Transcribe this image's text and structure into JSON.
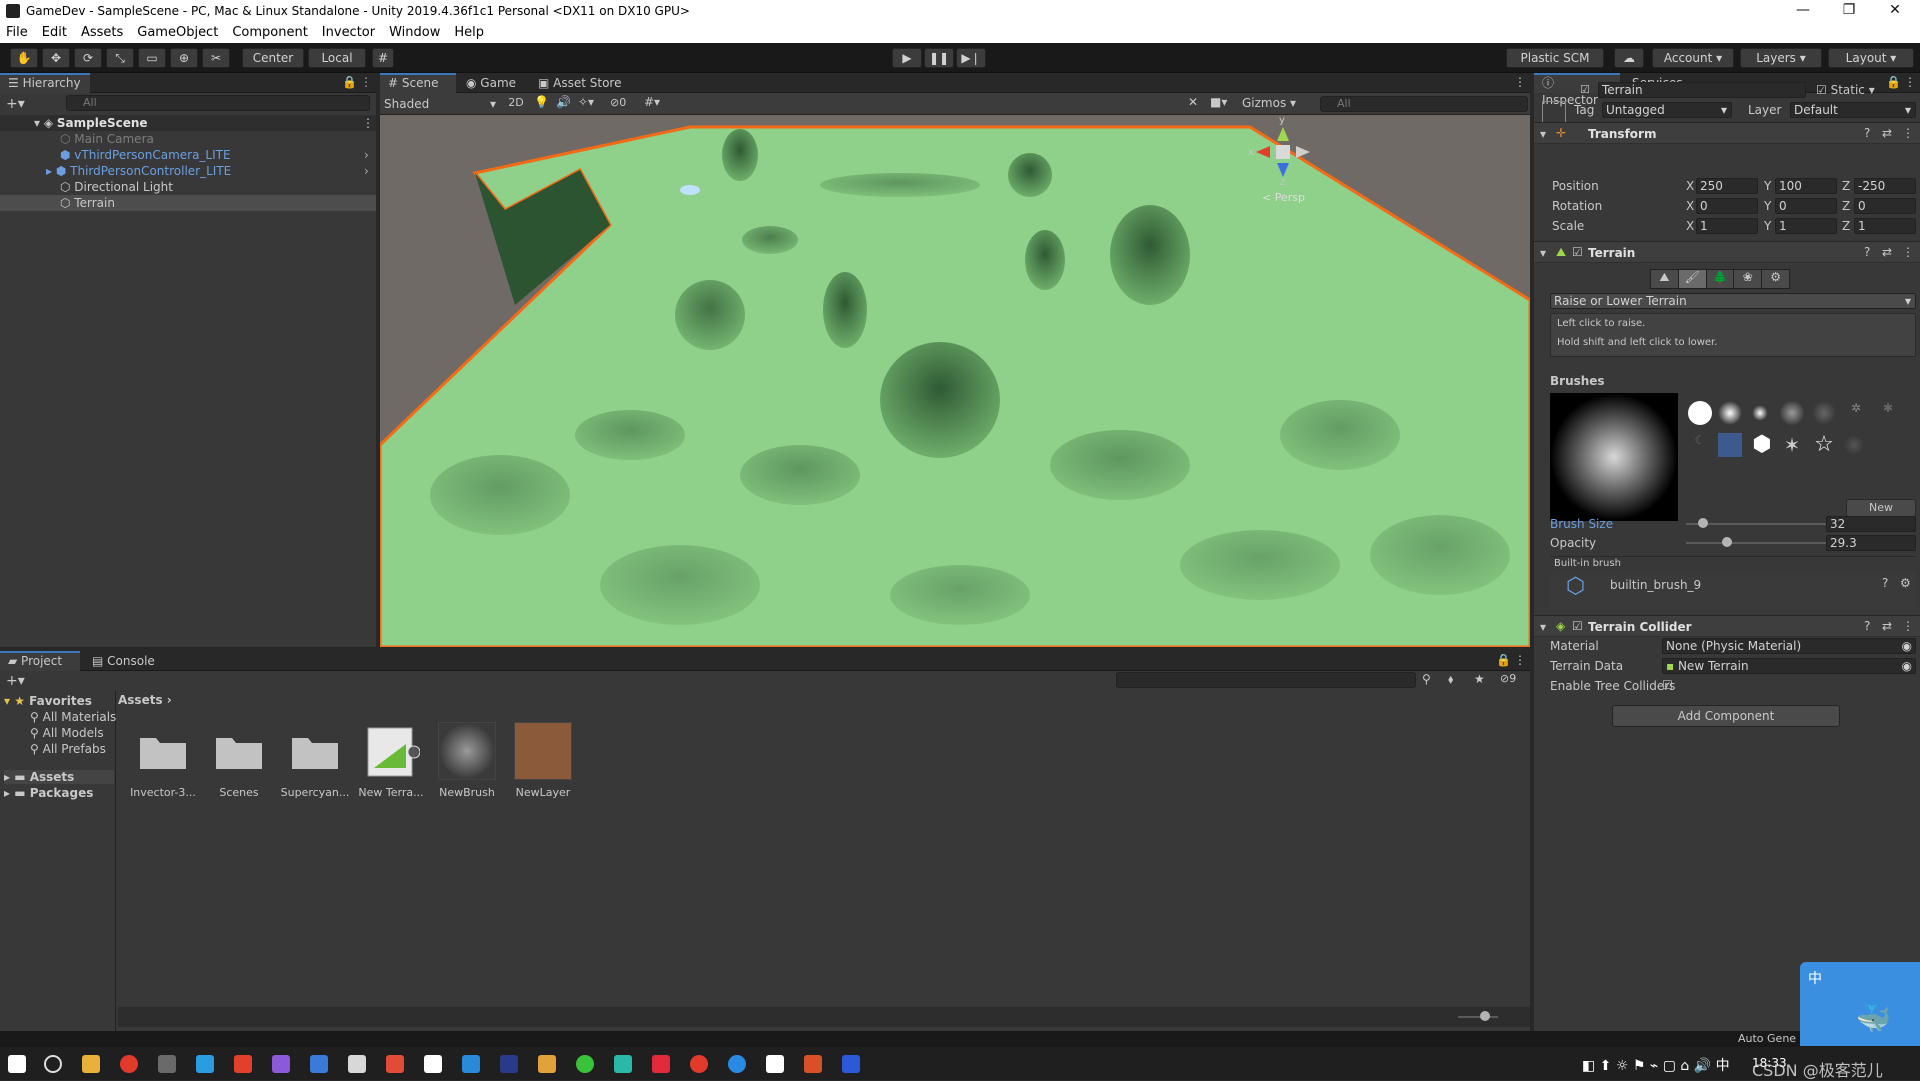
{
  "window": {
    "title": "GameDev - SampleScene - PC, Mac & Linux Standalone - Unity 2019.4.36f1c1 Personal <DX11 on DX10 GPU>",
    "controls": [
      "—",
      "❐",
      "✕"
    ]
  },
  "menu": [
    "File",
    "Edit",
    "Assets",
    "GameObject",
    "Component",
    "Invector",
    "Window",
    "Help"
  ],
  "toolbar": {
    "pivot_label": "Center",
    "space_label": "Local",
    "plastic_label": "Plastic SCM",
    "account_label": "Account",
    "layers_label": "Layers",
    "layout_label": "Layout"
  },
  "hierarchy": {
    "tab": "Hierarchy",
    "search_placeholder": "All",
    "scene_name": "SampleScene",
    "items": [
      {
        "label": "Main Camera",
        "color": "#7d7d7d"
      },
      {
        "label": "vThirdPersonCamera_LITE",
        "color": "#6a9fe0"
      },
      {
        "label": "ThirdPersonController_LITE",
        "color": "#6a9fe0"
      },
      {
        "label": "Directional Light",
        "color": "#c8c8c8"
      },
      {
        "label": "Terrain",
        "color": "#c8c8c8"
      }
    ]
  },
  "scene": {
    "tabs": [
      "Scene",
      "Game",
      "Asset Store"
    ],
    "shading": "Shaded",
    "mode_2d": "2D",
    "hidden_count": "0",
    "gizmos": "Gizmos",
    "search_placeholder": "All",
    "axis_y": "y",
    "axis_x": "x",
    "axis_z": "z",
    "persp": "< Persp"
  },
  "inspector": {
    "tabs": [
      "Inspector",
      "Services"
    ],
    "object_name": "Terrain",
    "static_label": "Static",
    "tag_label": "Tag",
    "tag_value": "Untagged",
    "layer_label": "Layer",
    "layer_value": "Default",
    "transform": {
      "title": "Transform",
      "rows": [
        {
          "label": "Position",
          "x": "250",
          "y": "100",
          "z": "-250"
        },
        {
          "label": "Rotation",
          "x": "0",
          "y": "0",
          "z": "0"
        },
        {
          "label": "Scale",
          "x": "1",
          "y": "1",
          "z": "1"
        }
      ],
      "axis_x": "X",
      "axis_y": "Y",
      "axis_z": "Z"
    },
    "terrain": {
      "title": "Terrain",
      "tool": "Raise or Lower Terrain",
      "help1": "Left click to raise.",
      "help2": "Hold shift and left click to lower.",
      "brushes_label": "Brushes",
      "new_brush": "New Brush...",
      "brush_size_label": "Brush Size",
      "brush_size_value": "32",
      "brush_size_fraction": 0.12,
      "opacity_label": "Opacity",
      "opacity_value": "29.3",
      "opacity_fraction": 0.29,
      "builtin_label": "Built-in brush",
      "brush_name": "builtin_brush_9"
    },
    "collider": {
      "title": "Terrain Collider",
      "material_label": "Material",
      "material_value": "None (Physic Material)",
      "data_label": "Terrain Data",
      "data_value": "New Terrain",
      "trees_label": "Enable Tree Colliders"
    },
    "add_component": "Add Component"
  },
  "project": {
    "tabs": [
      "Project",
      "Console"
    ],
    "favorites_label": "Favorites",
    "favorites": [
      "All Materials",
      "All Models",
      "All Prefabs"
    ],
    "tree": [
      "Assets",
      "Packages"
    ],
    "breadcrumb": "Assets",
    "hidden_count": "9",
    "assets": [
      "Invector-3...",
      "Scenes",
      "Supercyan...",
      "New Terra...",
      "NewBrush",
      "NewLayer"
    ]
  },
  "status": {
    "auto_generate": "Auto Gene"
  },
  "taskbar": {
    "clock": "18:33",
    "watermark": "CSDN @极客范儿"
  },
  "colors": {
    "accent": "#3a79bb",
    "terrain": "#8fd18a",
    "selection_outline": "#f36b16"
  }
}
